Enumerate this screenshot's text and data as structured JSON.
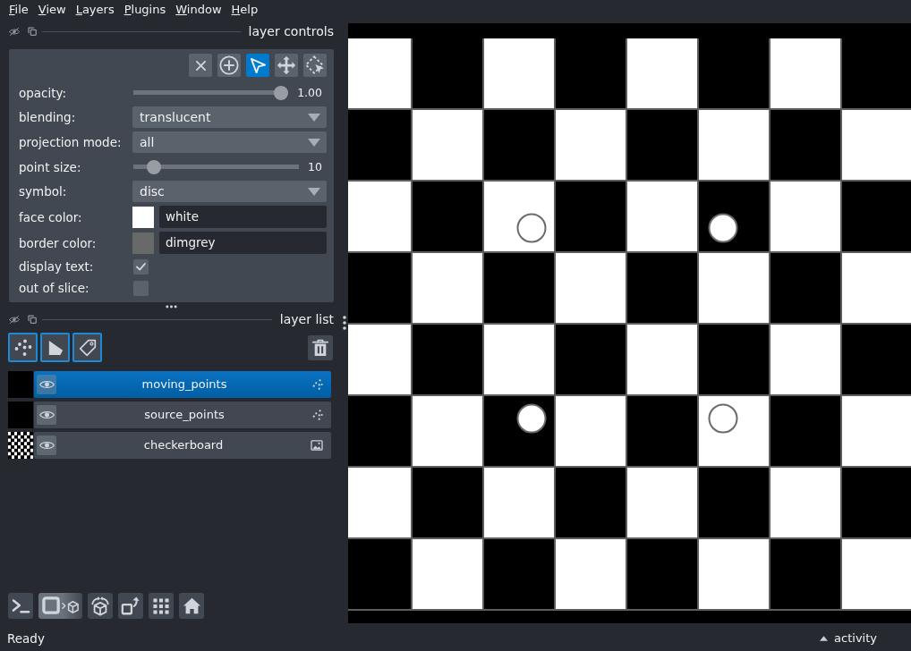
{
  "menu_bar": [
    "File",
    "View",
    "Layers",
    "Plugins",
    "Window",
    "Help"
  ],
  "layer_controls": {
    "title": "layer controls",
    "mode_buttons": [
      {
        "kind": "delete",
        "selected": false
      },
      {
        "kind": "add",
        "selected": false
      },
      {
        "kind": "select",
        "selected": true
      },
      {
        "kind": "pan_zoom",
        "selected": false
      },
      {
        "kind": "transform",
        "selected": false
      }
    ],
    "rows": [
      {
        "kind": "slider",
        "label": "opacity:",
        "level": 1.0,
        "reading": "1.00"
      },
      {
        "kind": "dropdown",
        "label": "blending:",
        "value": "translucent"
      },
      {
        "kind": "dropdown",
        "label": "projection mode:",
        "value": "all"
      },
      {
        "kind": "slider",
        "label": "point size:",
        "level": 0.09,
        "reading": "10"
      },
      {
        "kind": "dropdown",
        "label": "symbol:",
        "value": "disc"
      },
      {
        "kind": "color",
        "label": "face color:",
        "color": "#ffffff",
        "value": "white"
      },
      {
        "kind": "color",
        "label": "border color:",
        "color": "#696969",
        "value": "dimgrey"
      },
      {
        "kind": "checkbox",
        "label": "display text:",
        "checked": true
      },
      {
        "kind": "checkbox",
        "label": "out of slice:",
        "checked": false
      }
    ]
  },
  "layer_list": {
    "title": "layer list",
    "new_layer_buttons": [
      {
        "kind": "points"
      },
      {
        "kind": "shapes"
      },
      {
        "kind": "labels"
      }
    ],
    "layers": [
      {
        "name": "moving_points",
        "kind": "points",
        "selected": true,
        "visible": true
      },
      {
        "name": "source_points",
        "kind": "points",
        "selected": false,
        "visible": true
      },
      {
        "name": "checkerboard",
        "kind": "image",
        "selected": false,
        "visible": true
      }
    ]
  },
  "viewer_buttons": [
    {
      "kind": "console"
    },
    {
      "kind": "ndisplay"
    },
    {
      "kind": "roll"
    },
    {
      "kind": "transpose"
    },
    {
      "kind": "grid"
    },
    {
      "kind": "home"
    }
  ],
  "status_bar": {
    "message": "Ready",
    "activity": "activity"
  }
}
